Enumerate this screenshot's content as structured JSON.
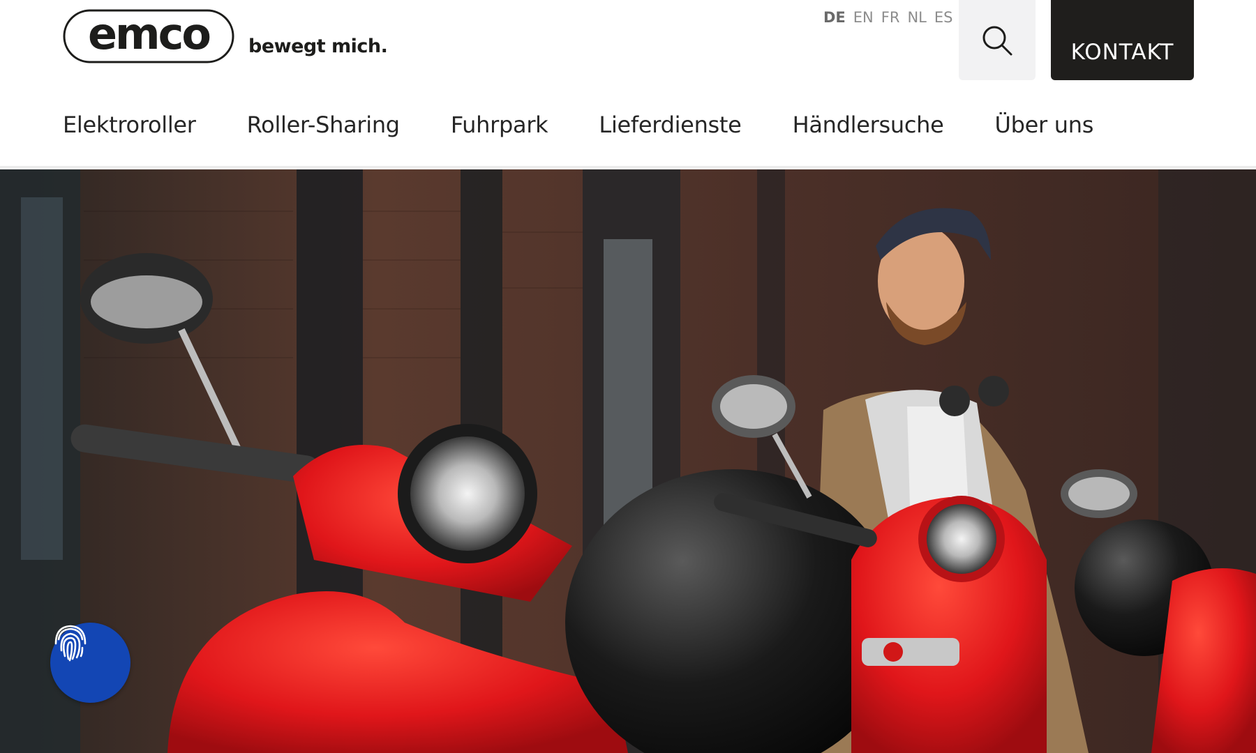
{
  "brand": {
    "logo_text": "emco",
    "tagline": "bewegt mich."
  },
  "languages": [
    {
      "code": "DE",
      "active": true
    },
    {
      "code": "EN",
      "active": false
    },
    {
      "code": "FR",
      "active": false
    },
    {
      "code": "NL",
      "active": false
    },
    {
      "code": "ES",
      "active": false
    }
  ],
  "header": {
    "search_icon": "search-icon",
    "kontakt_label": "KONTAKT"
  },
  "nav": {
    "items": [
      {
        "label": "Elektroroller"
      },
      {
        "label": "Roller-Sharing"
      },
      {
        "label": "Fuhrpark"
      },
      {
        "label": "Lieferdienste"
      },
      {
        "label": "Händlersuche"
      },
      {
        "label": "Über uns"
      }
    ]
  },
  "hero": {
    "image": "man-with-red-electric-scooters-photo",
    "privacy_icon": "fingerprint-icon"
  },
  "colors": {
    "kontakt_bg": "#1f1e1c",
    "search_bg": "#f2f2f3",
    "privacy_button": "#1346b4",
    "scooter_red": "#e01a1a"
  }
}
